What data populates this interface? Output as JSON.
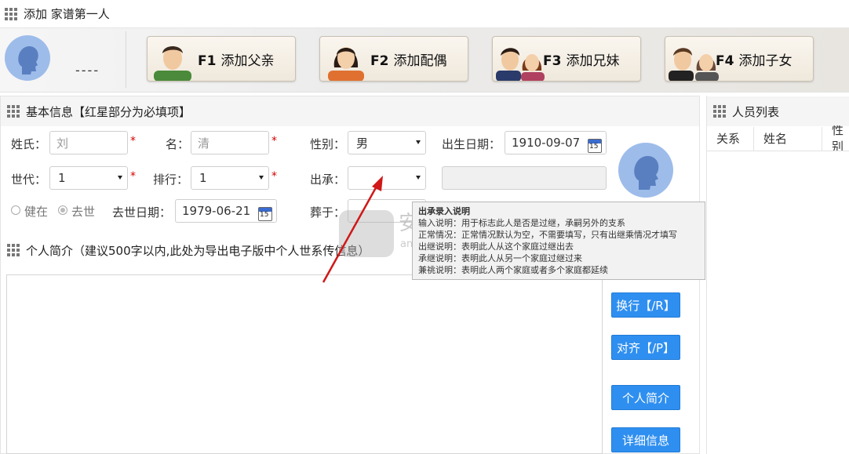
{
  "window": {
    "title": "添加 家谱第一人"
  },
  "top": {
    "placeholder_name": "----",
    "buttons": [
      {
        "key": "F1",
        "label": "添加父亲"
      },
      {
        "key": "F2",
        "label": "添加配偶"
      },
      {
        "key": "F3",
        "label": "添加兄妹"
      },
      {
        "key": "F4",
        "label": "添加子女"
      }
    ]
  },
  "basic": {
    "title": "基本信息【红星部分为必填项】",
    "surname_label": "姓氏：",
    "surname_value": "刘",
    "given_label": "名：",
    "given_value": "清",
    "gender_label": "性别：",
    "gender_value": "男",
    "birth_label": "出生日期：",
    "birth_value": "1910-09-07",
    "gen_label": "世代：",
    "gen_value": "1",
    "rank_label": "排行：",
    "rank_value": "1",
    "inherit_label": "出承：",
    "inherit_value": "",
    "alive_label": "健在",
    "dead_label": "去世",
    "death_label": "去世日期：",
    "death_value": "1979-06-21",
    "burial_label": "葬于：",
    "star": "*",
    "cal_day": "15"
  },
  "profile": {
    "title": "个人简介（建议500字以内,此处为导出电子版中个人世系传信息）",
    "buttons": [
      "换行【/R】",
      "对齐【/P】",
      "个人简介",
      "详细信息"
    ]
  },
  "tooltip": {
    "title": "出承录入说明",
    "lines": [
      "输入说明：用于标志此人是否是过继，承嗣另外的支系",
      "正常情况：正常情况默认为空，不需要填写，只有出继乘情况才填写",
      "出继说明：表明此人从这个家庭过继出去",
      "承继说明：表明此人从另一个家庭过继过来",
      "兼祧说明：表明此人两个家庭或者多个家庭都延续"
    ]
  },
  "people": {
    "title": "人员列表",
    "columns": [
      "关系",
      "姓名",
      "性别"
    ]
  },
  "watermark": {
    "text": "安下载",
    "sub": "anxz.com"
  }
}
